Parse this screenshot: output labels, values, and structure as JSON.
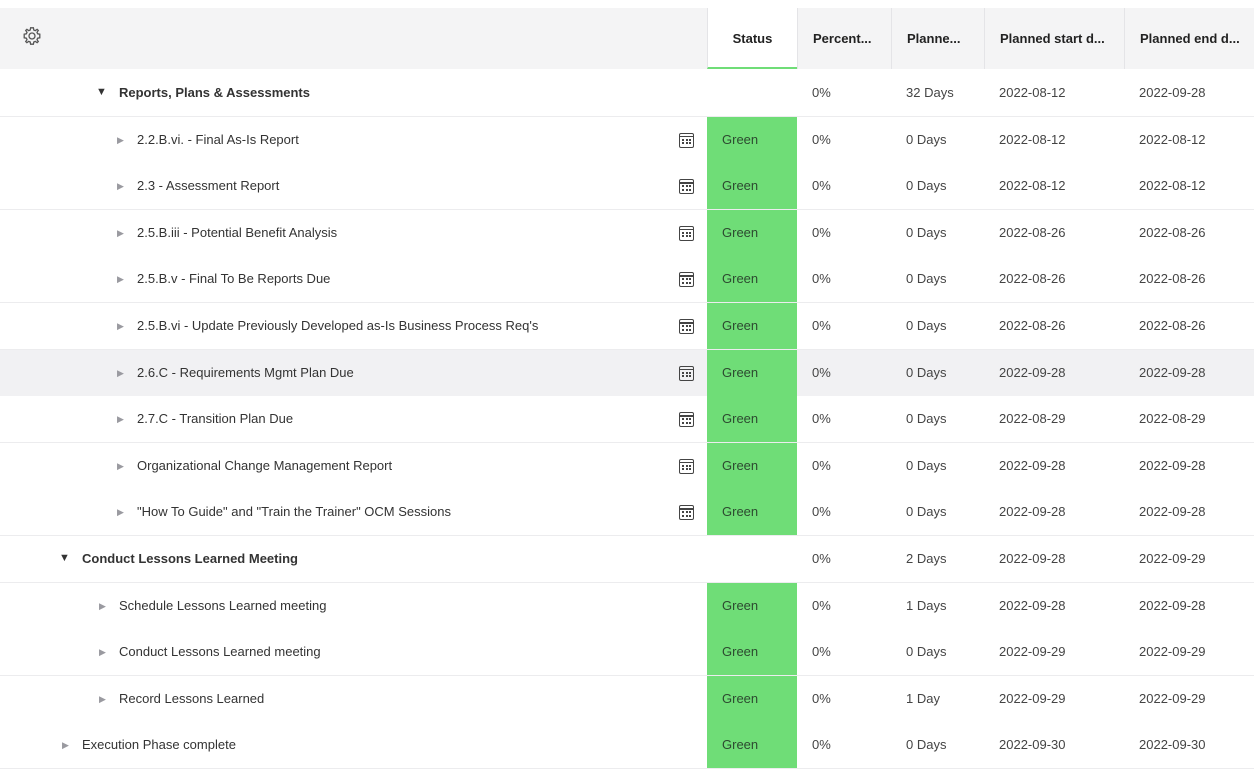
{
  "columns": {
    "status": "Status",
    "percent": "Percent...",
    "planned_duration": "Planne...",
    "planned_start": "Planned start d...",
    "planned_end": "Planned end d..."
  },
  "icons": {
    "settings": "gear-icon",
    "calendar": "calendar-icon"
  },
  "colors": {
    "status_green": "#6fdd77",
    "header_bg": "#f4f4f5",
    "highlight_row": "#f1f1f3"
  },
  "rows": [
    {
      "name": "Reports, Plans & Assessments",
      "level": 1,
      "expanded": true,
      "group": true,
      "calendar": false,
      "status": "",
      "percent": "0%",
      "duration": "32 Days",
      "start": "2022-08-12",
      "end": "2022-09-28"
    },
    {
      "name": "2.2.B.vi. - Final As-Is Report",
      "level": 2,
      "expanded": false,
      "group": false,
      "calendar": true,
      "status": "Green",
      "percent": "0%",
      "duration": "0 Days",
      "start": "2022-08-12",
      "end": "2022-08-12"
    },
    {
      "name": "2.3 - Assessment Report",
      "level": 2,
      "expanded": false,
      "group": false,
      "calendar": true,
      "status": "Green",
      "percent": "0%",
      "duration": "0 Days",
      "start": "2022-08-12",
      "end": "2022-08-12"
    },
    {
      "name": "2.5.B.iii - Potential Benefit Analysis",
      "level": 2,
      "expanded": false,
      "group": false,
      "calendar": true,
      "status": "Green",
      "percent": "0%",
      "duration": "0 Days",
      "start": "2022-08-26",
      "end": "2022-08-26"
    },
    {
      "name": "2.5.B.v - Final To Be Reports Due",
      "level": 2,
      "expanded": false,
      "group": false,
      "calendar": true,
      "status": "Green",
      "percent": "0%",
      "duration": "0 Days",
      "start": "2022-08-26",
      "end": "2022-08-26"
    },
    {
      "name": "2.5.B.vi - Update Previously Developed as-Is Business Process Req's",
      "level": 2,
      "expanded": false,
      "group": false,
      "calendar": true,
      "status": "Green",
      "percent": "0%",
      "duration": "0 Days",
      "start": "2022-08-26",
      "end": "2022-08-26"
    },
    {
      "name": "2.6.C - Requirements Mgmt Plan Due",
      "level": 2,
      "expanded": false,
      "group": false,
      "calendar": true,
      "highlight": true,
      "status": "Green",
      "percent": "0%",
      "duration": "0 Days",
      "start": "2022-09-28",
      "end": "2022-09-28"
    },
    {
      "name": "2.7.C - Transition Plan Due",
      "level": 2,
      "expanded": false,
      "group": false,
      "calendar": true,
      "status": "Green",
      "percent": "0%",
      "duration": "0 Days",
      "start": "2022-08-29",
      "end": "2022-08-29"
    },
    {
      "name": "Organizational Change Management Report",
      "level": 2,
      "expanded": false,
      "group": false,
      "calendar": true,
      "status": "Green",
      "percent": "0%",
      "duration": "0 Days",
      "start": "2022-09-28",
      "end": "2022-09-28"
    },
    {
      "name": "\"How To Guide\" and \"Train the Trainer\" OCM Sessions",
      "level": 2,
      "expanded": false,
      "group": false,
      "calendar": true,
      "status": "Green",
      "percent": "0%",
      "duration": "0 Days",
      "start": "2022-09-28",
      "end": "2022-09-28"
    },
    {
      "name": "Conduct Lessons Learned Meeting",
      "level": 0,
      "expanded": true,
      "group": true,
      "calendar": false,
      "status": "",
      "percent": "0%",
      "duration": "2 Days",
      "start": "2022-09-28",
      "end": "2022-09-29"
    },
    {
      "name": "Schedule Lessons Learned meeting",
      "level": 1,
      "expanded": false,
      "group": false,
      "calendar": false,
      "status": "Green",
      "percent": "0%",
      "duration": "1 Days",
      "start": "2022-09-28",
      "end": "2022-09-28"
    },
    {
      "name": "Conduct Lessons Learned meeting",
      "level": 1,
      "expanded": false,
      "group": false,
      "calendar": false,
      "status": "Green",
      "percent": "0%",
      "duration": "0 Days",
      "start": "2022-09-29",
      "end": "2022-09-29"
    },
    {
      "name": "Record Lessons Learned",
      "level": 1,
      "expanded": false,
      "group": false,
      "calendar": false,
      "status": "Green",
      "percent": "0%",
      "duration": "1 Day",
      "start": "2022-09-29",
      "end": "2022-09-29"
    },
    {
      "name": "Execution Phase complete",
      "level": 0,
      "expanded": false,
      "group": false,
      "calendar": false,
      "status": "Green",
      "percent": "0%",
      "duration": "0 Days",
      "start": "2022-09-30",
      "end": "2022-09-30"
    }
  ]
}
